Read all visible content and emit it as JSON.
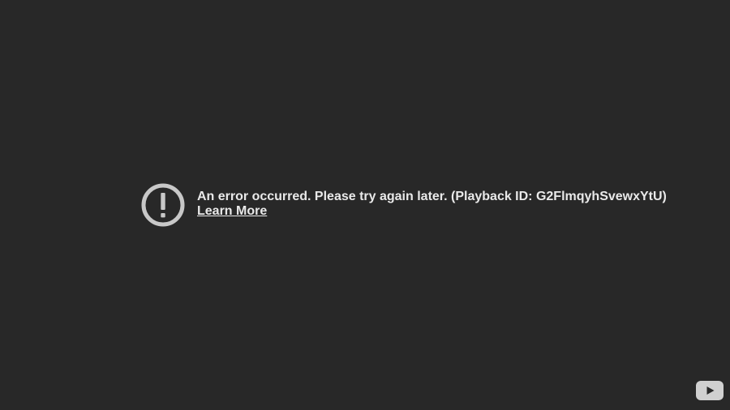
{
  "error": {
    "message": "An error occurred. Please try again later. (Playback ID: G2FlmqyhSvewxYtU)",
    "learn_more_label": "Learn More"
  },
  "icons": {
    "error": "exclamation-circle-icon",
    "logo": "youtube-logo-icon"
  },
  "colors": {
    "background": "#282828",
    "text": "#e9e9e9",
    "icon": "#c8c8c8",
    "logo": "#d0d0d0"
  }
}
